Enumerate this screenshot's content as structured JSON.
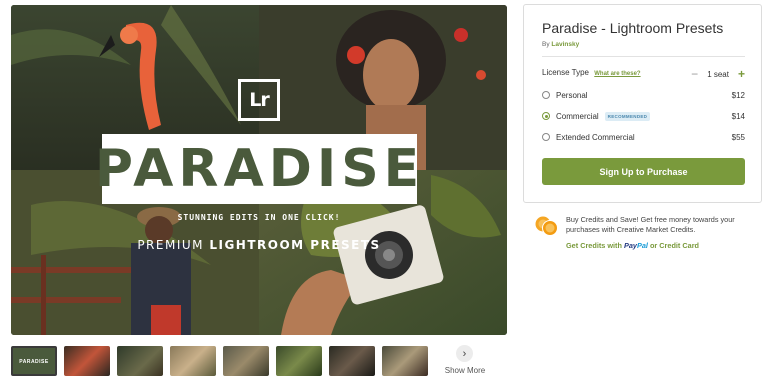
{
  "gallery": {
    "logo_text": "Lr",
    "title": "PARADISE",
    "tagline": "STUNNING EDITS IN ONE CLICK!",
    "subtitle_prefix": "PREMIUM",
    "subtitle_bold": "LIGHTROOM PRESETS",
    "thumb_label": "PARADISE",
    "show_more": "Show More",
    "show_more_icon": "chevron-right-icon"
  },
  "product": {
    "title": "Paradise - Lightroom Presets",
    "by_prefix": "By",
    "author": "Lavinsky"
  },
  "license": {
    "label": "License Type",
    "help_link": "What are these?",
    "seats": "1 seat",
    "options": [
      {
        "name": "Personal",
        "price": "$12",
        "selected": false,
        "badge": ""
      },
      {
        "name": "Commercial",
        "price": "$14",
        "selected": true,
        "badge": "RECOMMENDED"
      },
      {
        "name": "Extended Commercial",
        "price": "$55",
        "selected": false,
        "badge": ""
      }
    ]
  },
  "purchase_button": "Sign Up to Purchase",
  "credits": {
    "text": "Buy Credits and Save! Get free money towards your purchases with Creative Market Credits.",
    "link_prefix": "Get Credits with",
    "paypal_a": "Pay",
    "paypal_b": "Pal",
    "link_suffix": "or Credit Card"
  },
  "colors": {
    "accent": "#7a9a3c",
    "badge_bg": "#dcecf5",
    "badge_text": "#4a87ad",
    "coin": "#f5a623"
  }
}
